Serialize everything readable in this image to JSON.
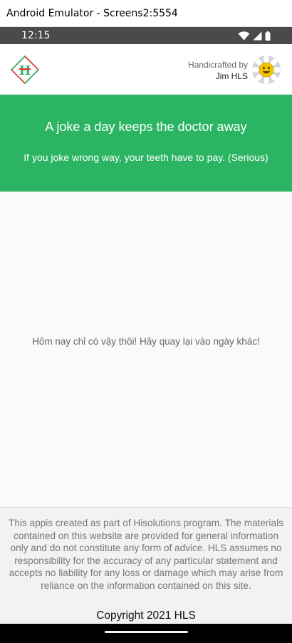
{
  "window": {
    "title": "Android Emulator - Screens2:5554"
  },
  "status_bar": {
    "time": "12:15",
    "icons": [
      "wifi-icon",
      "cell-signal-icon",
      "battery-icon"
    ]
  },
  "header": {
    "logo_text": "H",
    "credit_by": "Handicrafted by",
    "credit_name": "Jim HLS"
  },
  "hero": {
    "title": "A joke a day keeps the doctor away",
    "subtitle": "If you joke wrong way, your teeth have to pay. (Serious)"
  },
  "content": {
    "message": "Hôm nay chỉ có vậy thôi! Hãy quay lại vào ngày khác!"
  },
  "footer": {
    "disclaimer": "This appis created as part of Hisolutions program. The materials contained on this website are provided for general information only and do not constitute any form of advice. HLS assumes no responsibility for the accuracy of any particular statement and accepts no liability for any loss or damage which may arise from reliance on the information contained on this site.",
    "copyright": "Copyright 2021 HLS"
  },
  "colors": {
    "primary": "#2bb563",
    "logo_red": "#d9352b",
    "logo_green": "#2bb563",
    "status_bar": "#4a4a4a"
  }
}
